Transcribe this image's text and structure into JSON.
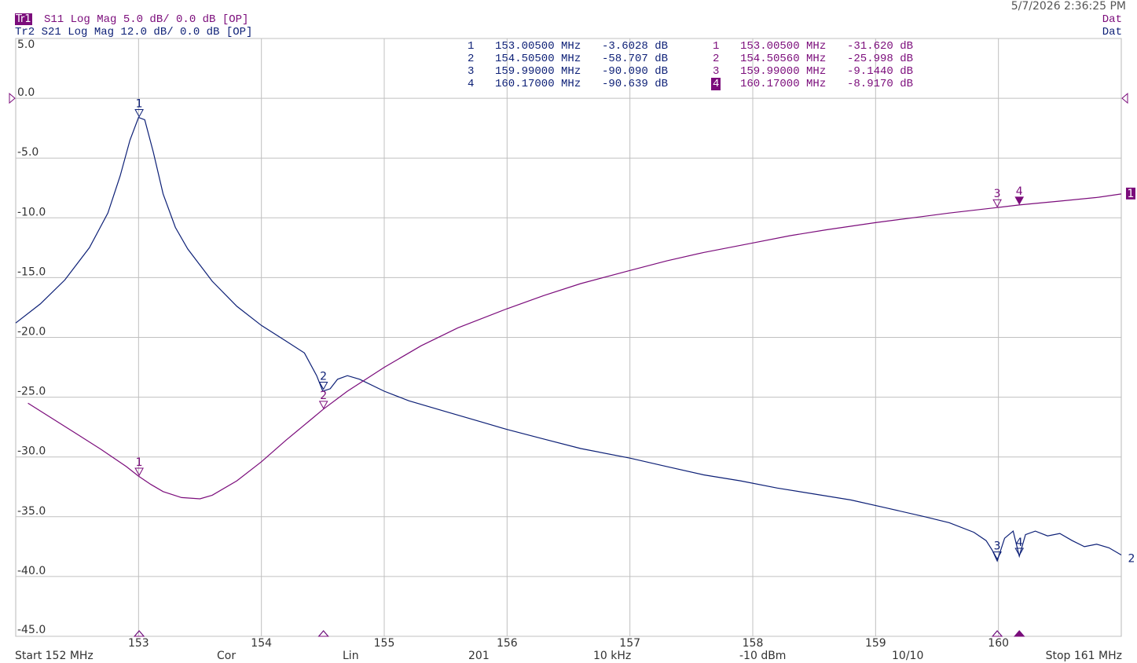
{
  "header": {
    "timestamp": "5/7/2026 2:36:25 PM",
    "trace1_tag": "Tr1",
    "trace1_text": "S11 Log Mag 5.0 dB/ 0.0 dB [OP]",
    "trace2_text": "Tr2 S21 Log Mag 12.0 dB/ 0.0 dB [OP]",
    "dat1": "Dat",
    "dat2": "Dat"
  },
  "marker_table": {
    "left": [
      {
        "num": "1",
        "freq": "153.00500 MHz",
        "val": "-3.6028 dB"
      },
      {
        "num": "2",
        "freq": "154.50500 MHz",
        "val": "-58.707 dB"
      },
      {
        "num": "3",
        "freq": "159.99000 MHz",
        "val": "-90.090 dB"
      },
      {
        "num": "4",
        "freq": "160.17000 MHz",
        "val": "-90.639 dB"
      }
    ],
    "right": [
      {
        "num": "1",
        "freq": "153.00500 MHz",
        "val": "-31.620 dB"
      },
      {
        "num": "2",
        "freq": "154.50560 MHz",
        "val": "-25.998 dB"
      },
      {
        "num": "3",
        "freq": "159.99000 MHz",
        "val": "-9.1440 dB"
      },
      {
        "num": "4",
        "freq": "160.17000 MHz",
        "val": "-8.9170 dB",
        "active": true
      }
    ]
  },
  "footer": {
    "start": "Start 152 MHz",
    "cor": "Cor",
    "lin": "Lin",
    "points": "201",
    "ifbw": "10 kHz",
    "power": "-10 dBm",
    "avg": "10/10",
    "stop": "Stop 161 MHz"
  },
  "colors": {
    "trace_navy": "#0c1f76",
    "trace_purple": "#7b0c7b",
    "grid": "#c0c0c0"
  },
  "chart_data": {
    "type": "line",
    "xlim": [
      152,
      161
    ],
    "ylim": [
      -45,
      5
    ],
    "y_ticks": [
      5,
      0,
      -5,
      -10,
      -15,
      -20,
      -25,
      -30,
      -35,
      -40,
      -45
    ],
    "y_tick_labels": [
      "5.0",
      "0.0",
      "-5.0",
      "-10.0",
      "-15.0",
      "-20.0",
      "-25.0",
      "-30.0",
      "-35.0",
      "-40.0",
      "-45.0"
    ],
    "x_ticks": [
      153,
      154,
      155,
      156,
      157,
      158,
      159,
      160
    ],
    "x_tick_labels": [
      "153",
      "154",
      "155",
      "156",
      "157",
      "158",
      "159",
      "160"
    ],
    "grid": true,
    "series": [
      {
        "name": "",
        "color": "#0c1f76",
        "end_label": "2",
        "points": [
          [
            152.0,
            -18.8
          ],
          [
            152.2,
            -17.2
          ],
          [
            152.4,
            -15.2
          ],
          [
            152.6,
            -12.5
          ],
          [
            152.75,
            -9.6
          ],
          [
            152.85,
            -6.5
          ],
          [
            152.93,
            -3.5
          ],
          [
            153.0,
            -1.6
          ],
          [
            153.05,
            -1.8
          ],
          [
            153.12,
            -4.5
          ],
          [
            153.2,
            -8.0
          ],
          [
            153.3,
            -10.8
          ],
          [
            153.4,
            -12.6
          ],
          [
            153.6,
            -15.3
          ],
          [
            153.8,
            -17.4
          ],
          [
            154.0,
            -19.0
          ],
          [
            154.2,
            -20.3
          ],
          [
            154.35,
            -21.3
          ],
          [
            154.45,
            -23.2
          ],
          [
            154.5,
            -24.5
          ],
          [
            154.56,
            -24.3
          ],
          [
            154.62,
            -23.5
          ],
          [
            154.7,
            -23.2
          ],
          [
            154.8,
            -23.5
          ],
          [
            155.0,
            -24.5
          ],
          [
            155.2,
            -25.3
          ],
          [
            155.5,
            -26.2
          ],
          [
            155.8,
            -27.1
          ],
          [
            156.0,
            -27.7
          ],
          [
            156.3,
            -28.5
          ],
          [
            156.6,
            -29.3
          ],
          [
            157.0,
            -30.1
          ],
          [
            157.3,
            -30.8
          ],
          [
            157.6,
            -31.5
          ],
          [
            157.9,
            -32.0
          ],
          [
            158.2,
            -32.6
          ],
          [
            158.5,
            -33.1
          ],
          [
            158.8,
            -33.6
          ],
          [
            159.1,
            -34.3
          ],
          [
            159.4,
            -35.0
          ],
          [
            159.6,
            -35.5
          ],
          [
            159.8,
            -36.3
          ],
          [
            159.9,
            -37.0
          ],
          [
            159.95,
            -37.8
          ],
          [
            159.99,
            -38.7
          ],
          [
            160.05,
            -36.8
          ],
          [
            160.12,
            -36.2
          ],
          [
            160.17,
            -38.3
          ],
          [
            160.22,
            -36.5
          ],
          [
            160.3,
            -36.2
          ],
          [
            160.4,
            -36.6
          ],
          [
            160.5,
            -36.4
          ],
          [
            160.6,
            -37.0
          ],
          [
            160.7,
            -37.5
          ],
          [
            160.8,
            -37.3
          ],
          [
            160.9,
            -37.6
          ],
          [
            161.0,
            -38.2
          ]
        ],
        "markers": [
          {
            "label": "1",
            "x": 153.005,
            "y": -1.6
          },
          {
            "label": "2",
            "x": 154.505,
            "y": -24.4
          },
          {
            "label": "3",
            "x": 159.99,
            "y": -38.6
          },
          {
            "label": "4",
            "x": 160.17,
            "y": -38.3
          }
        ]
      },
      {
        "name": "",
        "color": "#7b0c7b",
        "end_label": "1",
        "points": [
          [
            152.1,
            -25.5
          ],
          [
            152.3,
            -26.8
          ],
          [
            152.5,
            -28.1
          ],
          [
            152.7,
            -29.4
          ],
          [
            152.9,
            -30.8
          ],
          [
            153.0,
            -31.6
          ],
          [
            153.1,
            -32.3
          ],
          [
            153.2,
            -32.9
          ],
          [
            153.35,
            -33.4
          ],
          [
            153.5,
            -33.5
          ],
          [
            153.6,
            -33.2
          ],
          [
            153.8,
            -32.0
          ],
          [
            154.0,
            -30.4
          ],
          [
            154.2,
            -28.6
          ],
          [
            154.4,
            -26.9
          ],
          [
            154.505,
            -26.0
          ],
          [
            154.7,
            -24.5
          ],
          [
            155.0,
            -22.5
          ],
          [
            155.3,
            -20.7
          ],
          [
            155.6,
            -19.2
          ],
          [
            156.0,
            -17.6
          ],
          [
            156.3,
            -16.5
          ],
          [
            156.6,
            -15.5
          ],
          [
            157.0,
            -14.4
          ],
          [
            157.3,
            -13.6
          ],
          [
            157.6,
            -12.9
          ],
          [
            158.0,
            -12.1
          ],
          [
            158.3,
            -11.5
          ],
          [
            158.6,
            -11.0
          ],
          [
            159.0,
            -10.4
          ],
          [
            159.3,
            -10.0
          ],
          [
            159.6,
            -9.6
          ],
          [
            159.99,
            -9.14
          ],
          [
            160.17,
            -8.92
          ],
          [
            160.5,
            -8.6
          ],
          [
            160.8,
            -8.3
          ],
          [
            161.0,
            -8.0
          ]
        ],
        "markers": [
          {
            "label": "1",
            "x": 153.005,
            "y": -31.6
          },
          {
            "label": "2",
            "x": 154.5056,
            "y": -26.0
          },
          {
            "label": "3",
            "x": 159.99,
            "y": -9.14
          },
          {
            "label": "4",
            "x": 160.17,
            "y": -8.92,
            "active": true
          }
        ]
      }
    ],
    "reference_markers": [
      {
        "series": 1,
        "side": "left",
        "value": 0
      },
      {
        "series": 1,
        "side": "right",
        "value": 0
      }
    ]
  }
}
